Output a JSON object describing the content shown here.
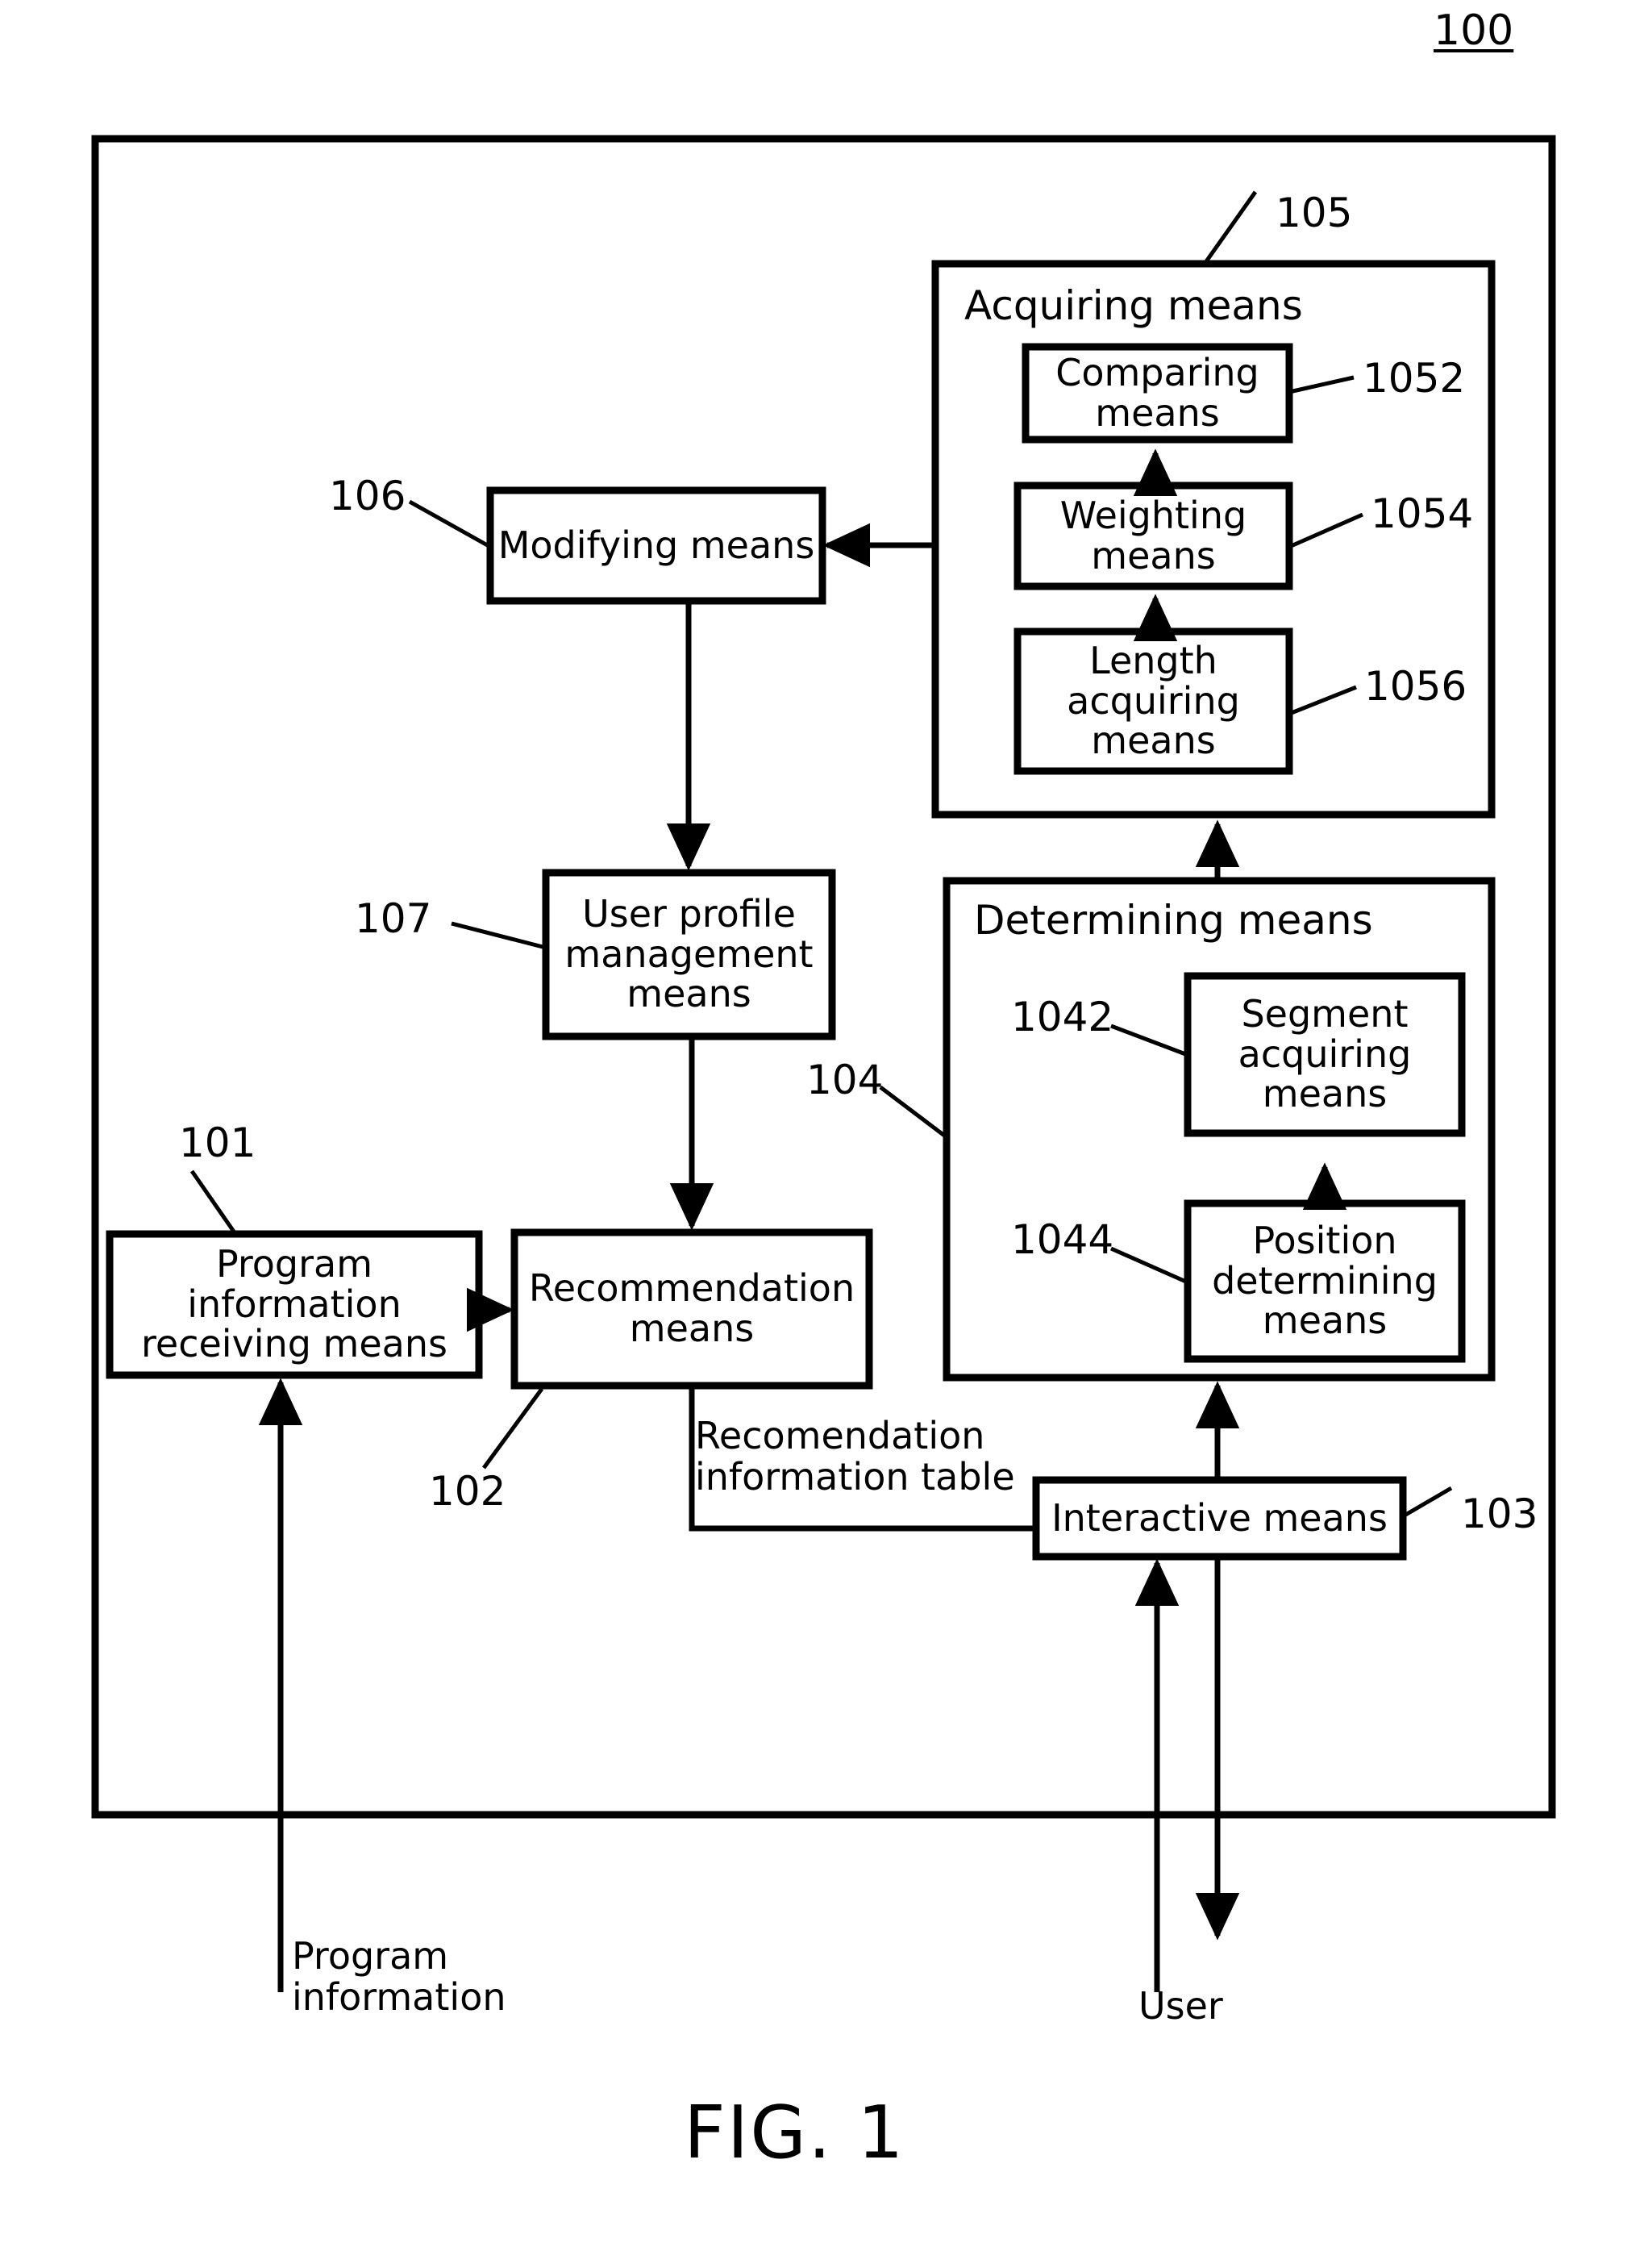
{
  "figure": {
    "caption": "FIG. 1",
    "top_reference": "100"
  },
  "system_frame": {
    "name": "system-boundary"
  },
  "groups": {
    "acquiring": {
      "title": "Acquiring means",
      "ref": "105",
      "children": [
        {
          "label": "Comparing\nmeans",
          "ref": "1052"
        },
        {
          "label": "Weighting\nmeans",
          "ref": "1054"
        },
        {
          "label": "Length\nacquiring\nmeans",
          "ref": "1056"
        }
      ]
    },
    "determining": {
      "title": "Determining means",
      "ref": "104",
      "children": [
        {
          "label": "Segment\nacquiring\nmeans",
          "ref": "1042"
        },
        {
          "label": "Position\ndetermining\nmeans",
          "ref": "1044"
        }
      ]
    }
  },
  "blocks": {
    "modifying": {
      "label": "Modifying means",
      "ref": "106"
    },
    "user_profile": {
      "label": "User profile\nmanagement\nmeans",
      "ref": "107"
    },
    "program_info_receiving": {
      "label": "Program\ninformation\nreceiving means",
      "ref": "101"
    },
    "recommendation": {
      "label": "Recommendation\nmeans",
      "ref": "102"
    },
    "interactive": {
      "label": "Interactive means",
      "ref": "103"
    }
  },
  "edge_labels": {
    "recommendation_table": "Recomendation\ninformation table",
    "program_information": "Program\ninformation",
    "user": "User"
  }
}
